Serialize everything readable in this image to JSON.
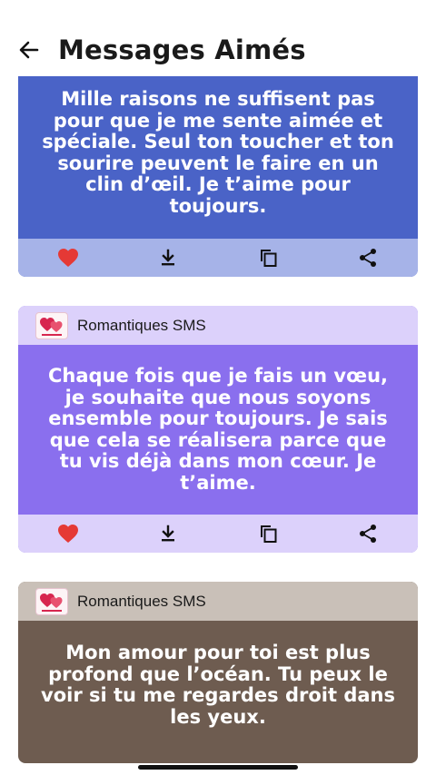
{
  "header": {
    "title": "Messages Aimés",
    "back_icon": "arrow-left-icon"
  },
  "colors": {
    "card1_bg": "#4a63c7",
    "card2_bg": "#8a6fee",
    "card3_bg": "#6e5c50",
    "heart": "#e53935"
  },
  "cards": [
    {
      "message": "Mille raisons ne suffisent pas pour que je me sente aimée et spéciale. Seul ton toucher et ton sourire peuvent le faire en un clin d’œil. Je t’aime pour toujours.",
      "actions": [
        "heart-icon",
        "download-icon",
        "copy-icon",
        "share-icon"
      ]
    },
    {
      "app_name": "Romantiques SMS",
      "message": "Chaque fois que je fais un vœu, je souhaite que nous soyons ensemble pour toujours. Je sais que cela se réalisera parce que tu vis déjà dans mon cœur. Je t’aime.",
      "actions": [
        "heart-icon",
        "download-icon",
        "copy-icon",
        "share-icon"
      ]
    },
    {
      "app_name": "Romantiques SMS",
      "message": "Mon amour pour toi est plus profond que l’océan. Tu peux le voir si tu me regardes droit dans les yeux."
    }
  ]
}
